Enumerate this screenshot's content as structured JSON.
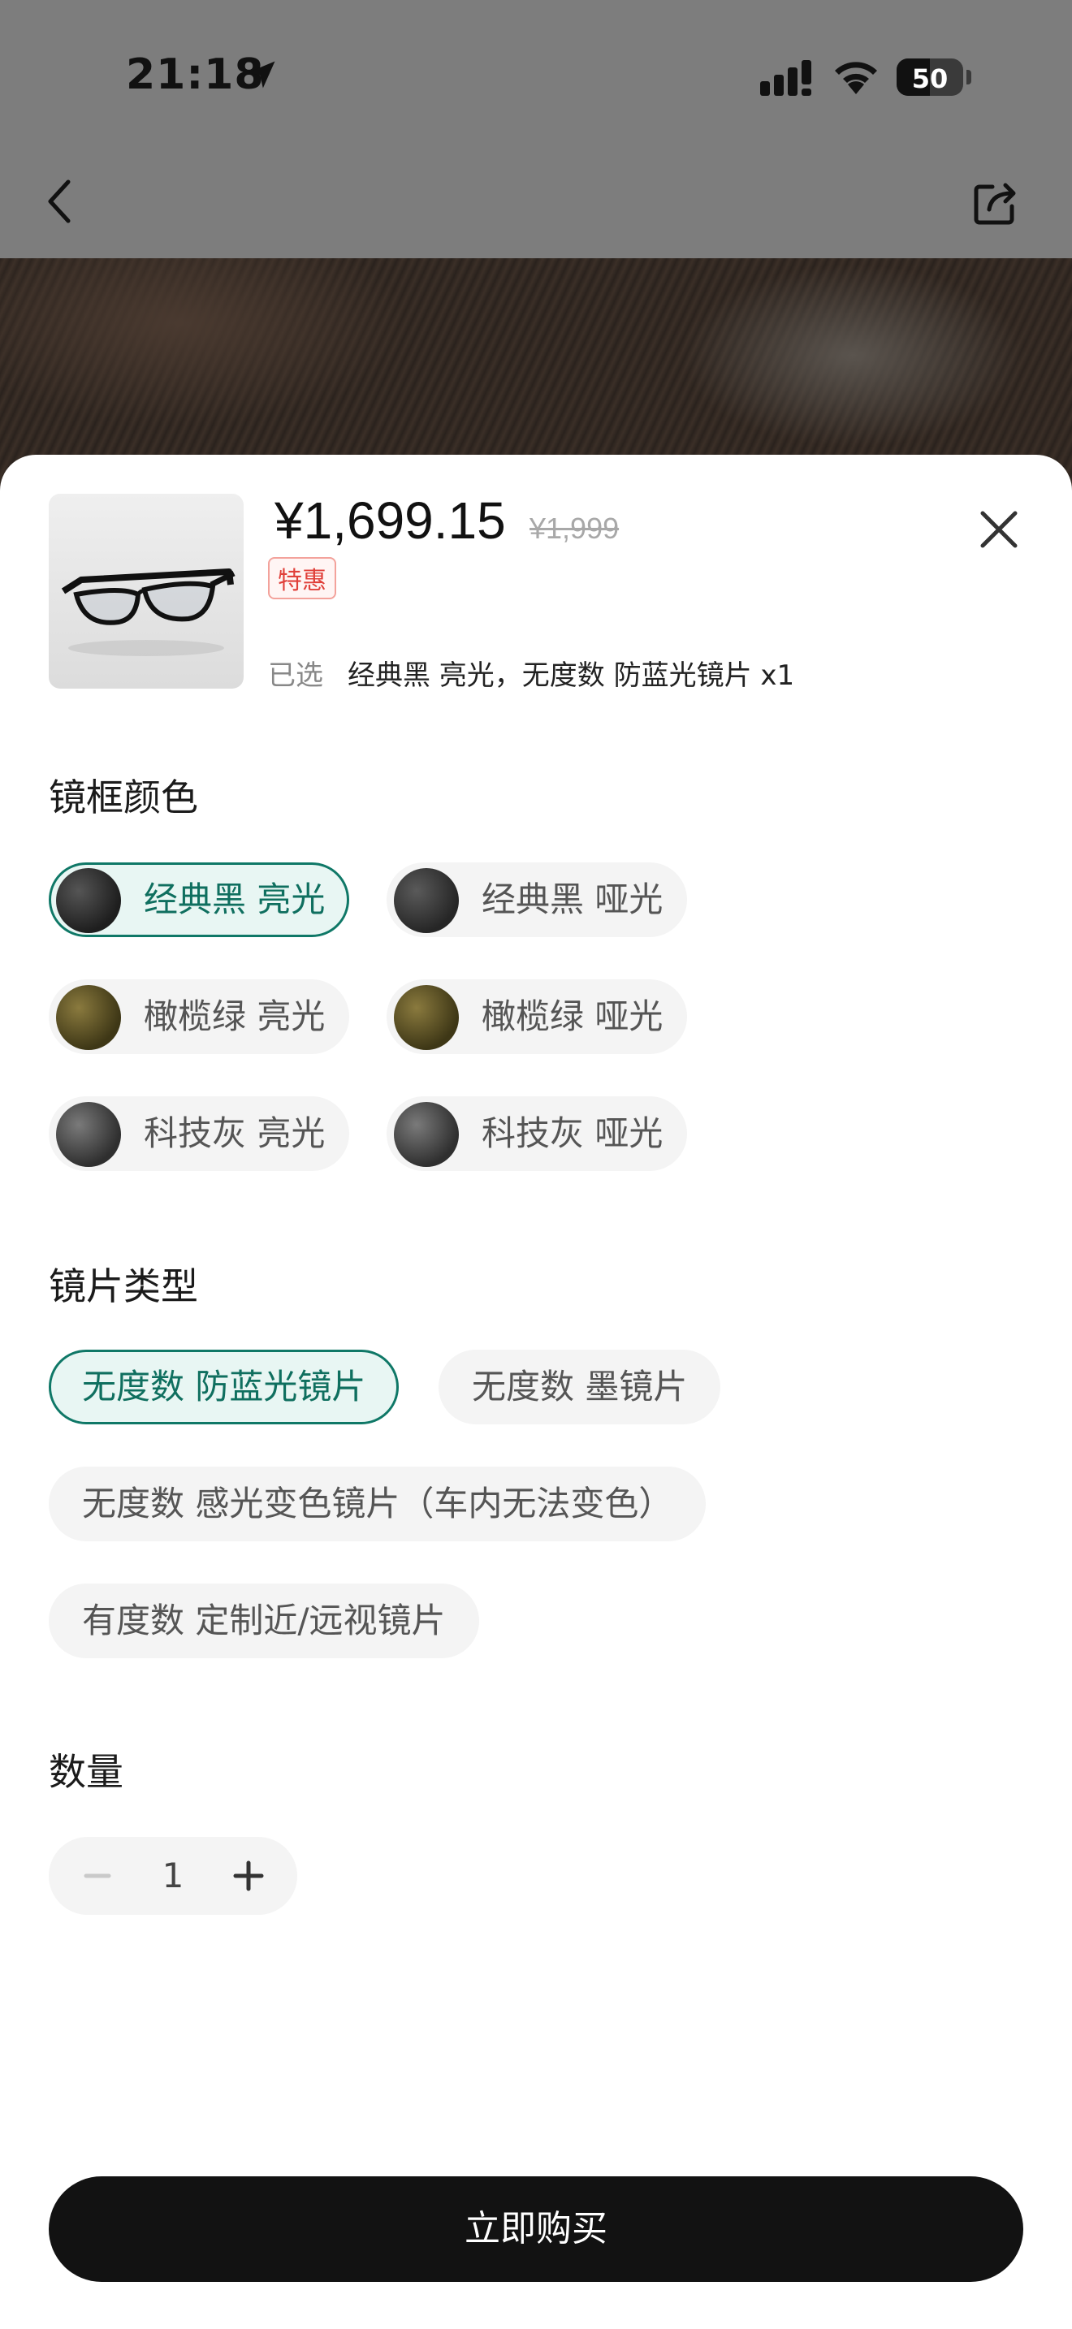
{
  "status_bar": {
    "time": "21:18",
    "battery": "50",
    "battery_level": 0.5
  },
  "product": {
    "price": "¥1,699.15",
    "original_price": "¥1,999",
    "promo_badge": "特惠",
    "selected_label": "已选",
    "selected_value": "经典黑 亮光，无度数 防蓝光镜片 x1"
  },
  "frame_color": {
    "title": "镜框颜色",
    "options": [
      {
        "label": "经典黑 亮光",
        "swatch_color": "#2b2b2b",
        "selected": true
      },
      {
        "label": "经典黑 哑光",
        "swatch_color": "#333333",
        "selected": false
      },
      {
        "label": "橄榄绿 亮光",
        "swatch_color": "#5f5530",
        "selected": false
      },
      {
        "label": "橄榄绿 哑光",
        "swatch_color": "#5f5530",
        "selected": false
      },
      {
        "label": "科技灰 亮光",
        "swatch_color": "#4a4a4a",
        "selected": false
      },
      {
        "label": "科技灰 哑光",
        "swatch_color": "#4a4a4a",
        "selected": false
      }
    ]
  },
  "lens_type": {
    "title": "镜片类型",
    "options": [
      {
        "label": "无度数 防蓝光镜片",
        "selected": true
      },
      {
        "label": "无度数 墨镜片",
        "selected": false
      },
      {
        "label": "无度数 感光变色镜片（车内无法变色）",
        "selected": false
      },
      {
        "label": "有度数 定制近/远视镜片",
        "selected": false
      }
    ]
  },
  "quantity": {
    "title": "数量",
    "value": "1"
  },
  "buy_button": "立即购买",
  "colors": {
    "accent": "#0f7867",
    "accent_bg": "#e8f6f3",
    "promo": "#e0403a",
    "button": "#121212"
  }
}
